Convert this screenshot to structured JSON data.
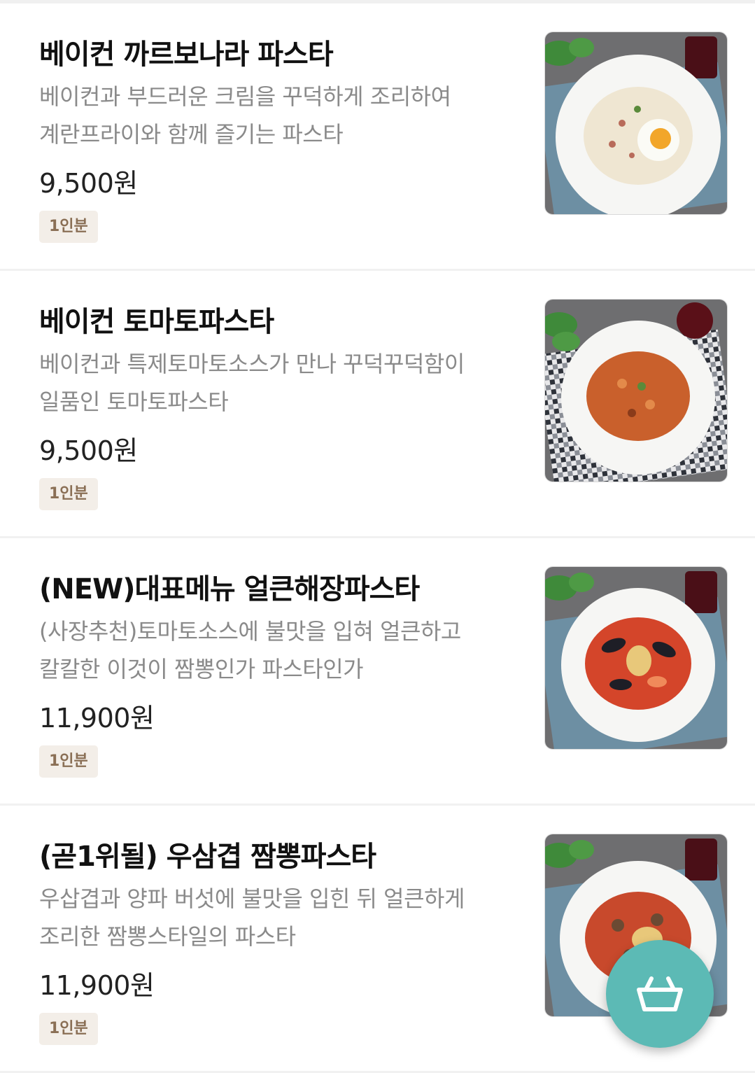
{
  "menu_items": [
    {
      "name": "베이컨 까르보나라 파스타",
      "desc_line1": "베이컨과 부드러운 크림을 꾸덕하게 조리하여",
      "desc_line2": "계란프라이와 함께 즐기는 파스타",
      "price": "9,500원",
      "badge": "1인분",
      "sauce_color": "#efe6d2",
      "cloth_color": "#6d8fa3"
    },
    {
      "name": "베이컨 토마토파스타",
      "desc_line1": "베이컨과 특제토마토소스가 만나 꾸덕꾸덕함이",
      "desc_line2": "일품인 토마토파스타",
      "price": "9,500원",
      "badge": "1인분",
      "sauce_color": "#c9602c",
      "cloth_color": "#3a3f4a"
    },
    {
      "name": "(NEW)대표메뉴 얼큰해장파스타",
      "desc_line1": "(사장추천)토마토소스에 불맛을 입혀 얼큰하고",
      "desc_line2": "칼칼한 이것이 짬뽕인가 파스타인가",
      "price": "11,900원",
      "badge": "1인분",
      "sauce_color": "#d4452a",
      "cloth_color": "#6d8fa3"
    },
    {
      "name": "(곧1위될) 우삼겹 짬뽕파스타",
      "desc_line1": "우삽겹과 양파 버섯에 불맛을 입힌 뒤 얼큰하게",
      "desc_line2": "조리한 짬뽕스타일의 파스타",
      "price": "11,900원",
      "badge": "1인분",
      "sauce_color": "#c8492c",
      "cloth_color": "#6d8fa3"
    }
  ],
  "cart_button": {
    "icon": "basket-icon",
    "color": "#5cbab5"
  }
}
